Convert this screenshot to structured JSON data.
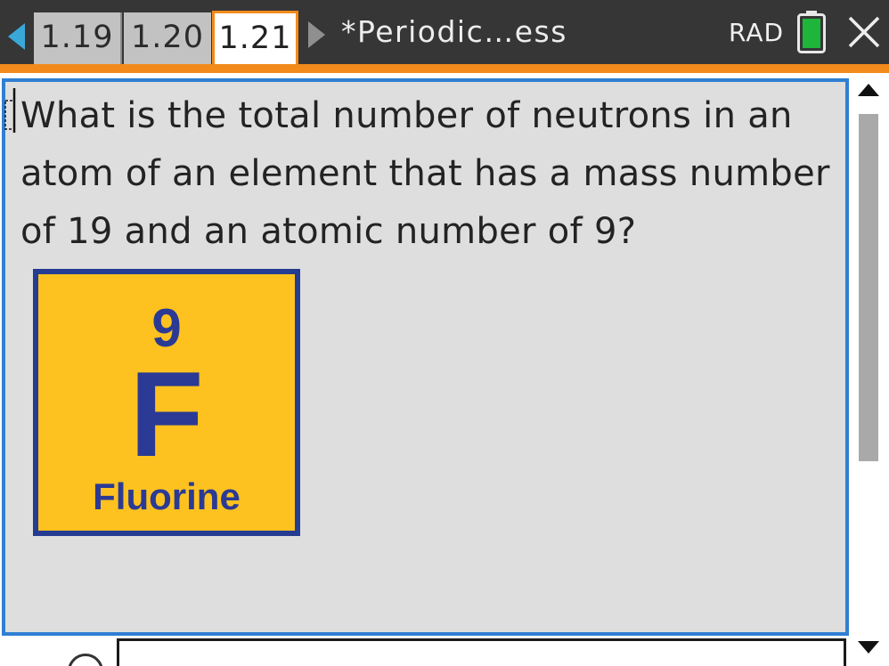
{
  "header": {
    "tabs": [
      {
        "label": "1.19",
        "active": false
      },
      {
        "label": "1.20",
        "active": false
      },
      {
        "label": "1.21",
        "active": true
      }
    ],
    "document_title": "*Periodic…ess",
    "angle_mode": "RAD",
    "icons": {
      "prev": "triangle-left-icon",
      "next": "triangle-right-icon",
      "battery": "battery-icon",
      "close": "close-icon"
    },
    "colors": {
      "accent": "#f28a1c",
      "active_arrow": "#3aa7d9",
      "battery_level": "#1db53a"
    }
  },
  "question": {
    "text": "What is the total number of neutrons in an atom of an element that has a mass number of 19 and an atomic number of 9?"
  },
  "element_card": {
    "atomic_number": "9",
    "symbol": "F",
    "name": "Fluorine",
    "colors": {
      "background": "#fdc21f",
      "foreground": "#2b3a94"
    }
  },
  "scrollbar": {
    "up_icon": "scroll-up-arrow-icon",
    "down_icon": "scroll-down-arrow-icon"
  }
}
